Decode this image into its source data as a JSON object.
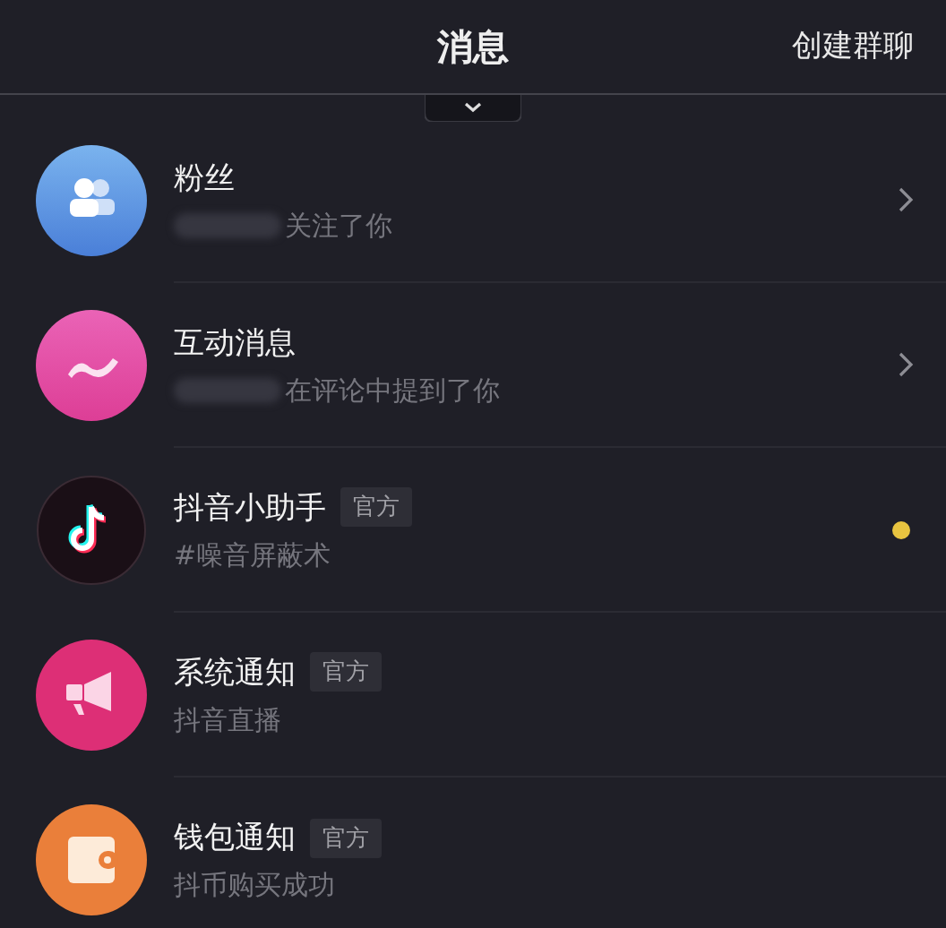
{
  "header": {
    "title": "消息",
    "action": "创建群聊"
  },
  "items": [
    {
      "kind": "fans",
      "name": "粉丝",
      "masked": true,
      "subtitle": "关注了你",
      "chevron": true
    },
    {
      "kind": "interaction",
      "name": "互动消息",
      "masked": true,
      "subtitle": "在评论中提到了你",
      "chevron": true
    },
    {
      "kind": "assistant",
      "name": "抖音小助手",
      "badge": "官方",
      "subtitle": "#噪音屏蔽术",
      "unread": true,
      "color": "#e8c440"
    },
    {
      "kind": "system",
      "name": "系统通知",
      "badge": "官方",
      "subtitle": "抖音直播"
    },
    {
      "kind": "wallet",
      "name": "钱包通知",
      "badge": "官方",
      "subtitle": "抖币购买成功"
    }
  ]
}
